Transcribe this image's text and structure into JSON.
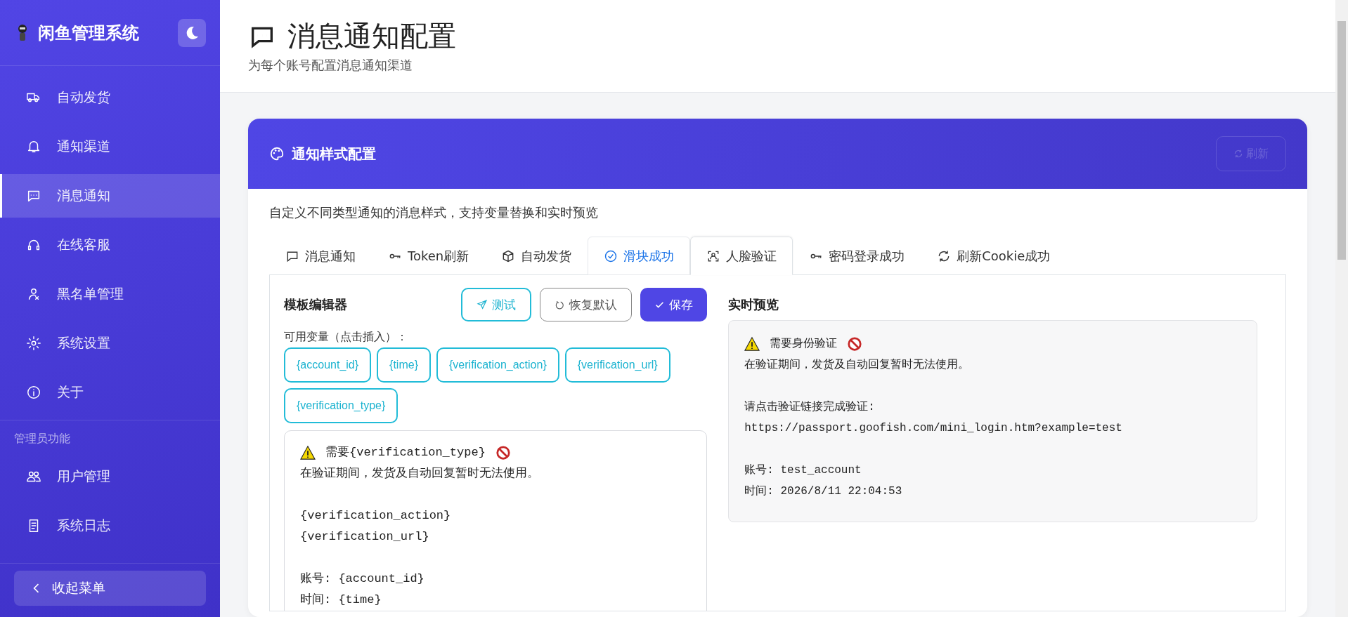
{
  "sidebar": {
    "title": "闲鱼管理系统",
    "items": [
      {
        "label": "自动发货",
        "selected": false
      },
      {
        "label": "通知渠道",
        "selected": false
      },
      {
        "label": "消息通知",
        "selected": true
      },
      {
        "label": "在线客服",
        "selected": false
      },
      {
        "label": "黑名单管理",
        "selected": false
      },
      {
        "label": "系统设置",
        "selected": false
      },
      {
        "label": "关于",
        "selected": false
      }
    ],
    "section_label": "管理员功能",
    "admin_items": [
      {
        "label": "用户管理",
        "selected": false
      },
      {
        "label": "系统日志",
        "selected": false
      }
    ],
    "collapse_button": "收起菜单"
  },
  "header": {
    "title": "消息通知配置",
    "subtitle": "为每个账号配置消息通知渠道"
  },
  "card": {
    "title": "通知样式配置",
    "refresh_button": {
      "label": "刷新",
      "disabled": true
    },
    "description": "自定义不同类型通知的消息样式，支持变量替换和实时预览",
    "tabs": [
      {
        "label": "消息通知",
        "selected": false,
        "hovered": false
      },
      {
        "label": "Token刷新",
        "selected": false,
        "hovered": false
      },
      {
        "label": "自动发货",
        "selected": false,
        "hovered": false
      },
      {
        "label": "滑块成功",
        "selected": false,
        "hovered": true
      },
      {
        "label": "人脸验证",
        "selected": true,
        "hovered": false
      },
      {
        "label": "密码登录成功",
        "selected": false,
        "hovered": false
      },
      {
        "label": "刷新Cookie成功",
        "selected": false,
        "hovered": false
      }
    ],
    "editor": {
      "title": "模板编辑器",
      "buttons": [
        {
          "label": "测试",
          "kind": "test"
        },
        {
          "label": "恢复默认",
          "kind": "reset"
        },
        {
          "label": "保存",
          "kind": "save"
        }
      ],
      "variables_label": "可用变量（点击插入）：",
      "variables": [
        "{account_id}",
        "{time}",
        "{verification_action}",
        "{verification_url}",
        "{verification_type}"
      ],
      "paragraphs": [
        [
          {
            "kind": "alert",
            "text": "需要{verification_type}"
          },
          {
            "kind": "text",
            "text": "在验证期间，发货及自动回复暂时无法使用。"
          }
        ],
        [
          {
            "kind": "text",
            "text": "{verification_action}"
          },
          {
            "kind": "text",
            "text": "{verification_url}"
          }
        ],
        [
          {
            "kind": "text",
            "text": "账号: {account_id}"
          },
          {
            "kind": "text",
            "text": "时间: {time}"
          }
        ]
      ]
    },
    "preview": {
      "title": "实时预览",
      "paragraphs": [
        [
          {
            "kind": "alert",
            "text": "需要身份验证"
          },
          {
            "kind": "text",
            "text": "在验证期间，发货及自动回复暂时无法使用。"
          }
        ],
        [
          {
            "kind": "text",
            "text": "请点击验证链接完成验证:"
          },
          {
            "kind": "text",
            "text": "https://passport.goofish.com/mini_login.htm?example=test"
          }
        ],
        [
          {
            "kind": "text",
            "text": "账号: test_account"
          },
          {
            "kind": "text",
            "text": "时间: 2026/8/11 22:04:53"
          }
        ]
      ]
    }
  }
}
